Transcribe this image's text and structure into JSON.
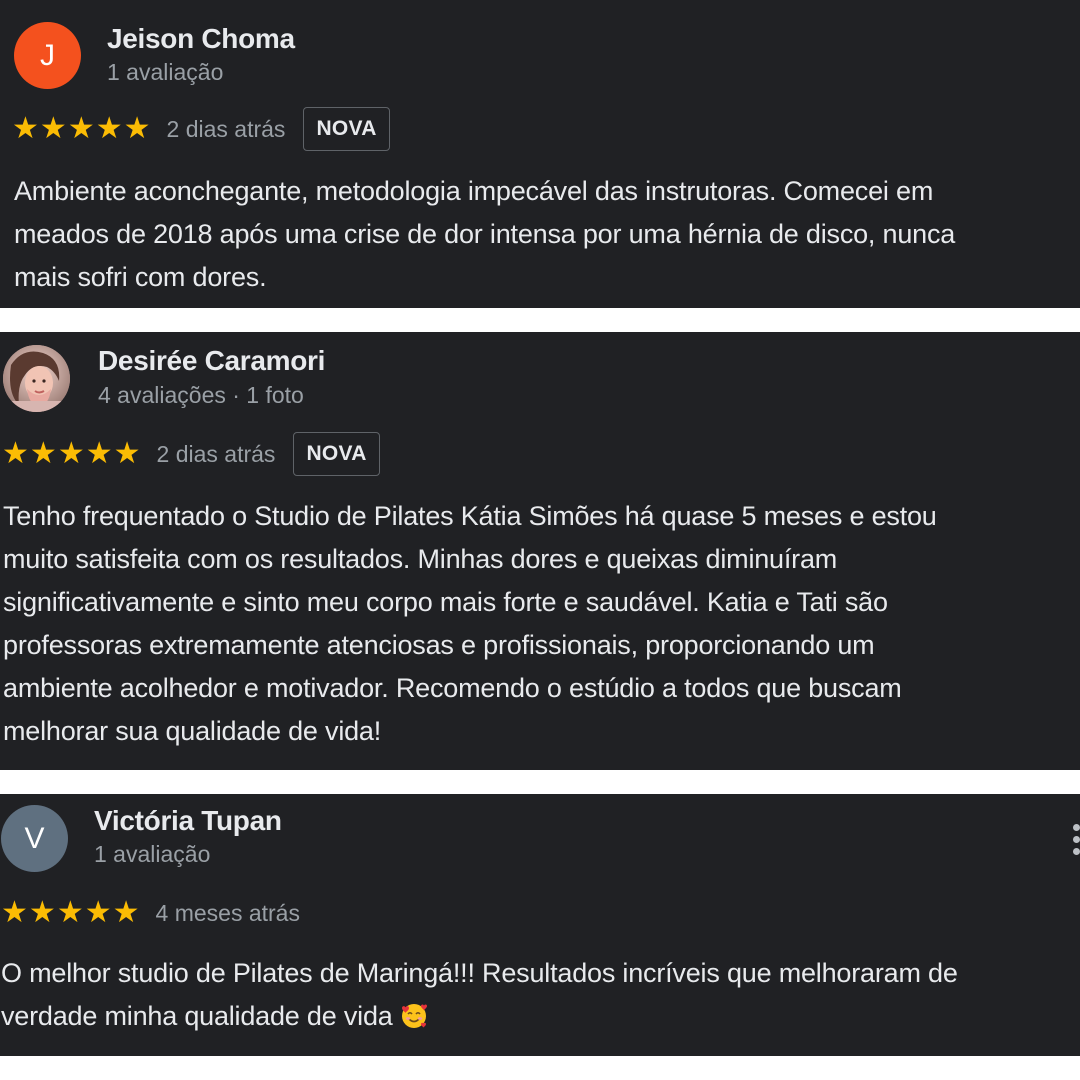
{
  "colors": {
    "card_bg": "#202124",
    "text_primary": "#e8eaed",
    "text_secondary": "#9aa0a6",
    "star": "#fbbc04",
    "avatar_j": "#f4511e",
    "avatar_v": "#5f7080"
  },
  "reviews": [
    {
      "avatar_letter": "J",
      "name": "Jeison Choma",
      "meta": "1 avaliação",
      "stars": 5,
      "date": "2 dias atrás",
      "badge": "NOVA",
      "text": "Ambiente aconchegante, metodologia impecável das instrutoras. Comecei em\nmeados de 2018 após uma crise de dor intensa por uma hérnia de disco, nunca\nmais sofri com dores."
    },
    {
      "avatar_letter": "",
      "avatar_icon": "profile-photo",
      "name": "Desirée Caramori",
      "meta": "4 avaliações · 1 foto",
      "stars": 5,
      "date": "2 dias atrás",
      "badge": "NOVA",
      "text": "Tenho frequentado o Studio de Pilates Kátia Simões há quase 5 meses e estou\nmuito satisfeita com os resultados. Minhas dores e queixas diminuíram\nsignificativamente e sinto meu corpo mais forte e saudável. Katia e Tati são\nprofessoras extremamente atenciosas e profissionais, proporcionando um\nambiente acolhedor e motivador. Recomendo o estúdio a todos que buscam\nmelhorar sua qualidade de vida!"
    },
    {
      "avatar_letter": "V",
      "name": "Victória Tupan",
      "meta": "1 avaliação",
      "stars": 5,
      "date": "4 meses atrás",
      "badge": "",
      "text": "O melhor studio de Pilates de Maringá!!! Resultados incríveis que melhoraram de\nverdade minha qualidade de vida",
      "emoji_icon": "smiling-face-with-hearts-icon",
      "menu_icon": "more-vertical-icon"
    }
  ]
}
